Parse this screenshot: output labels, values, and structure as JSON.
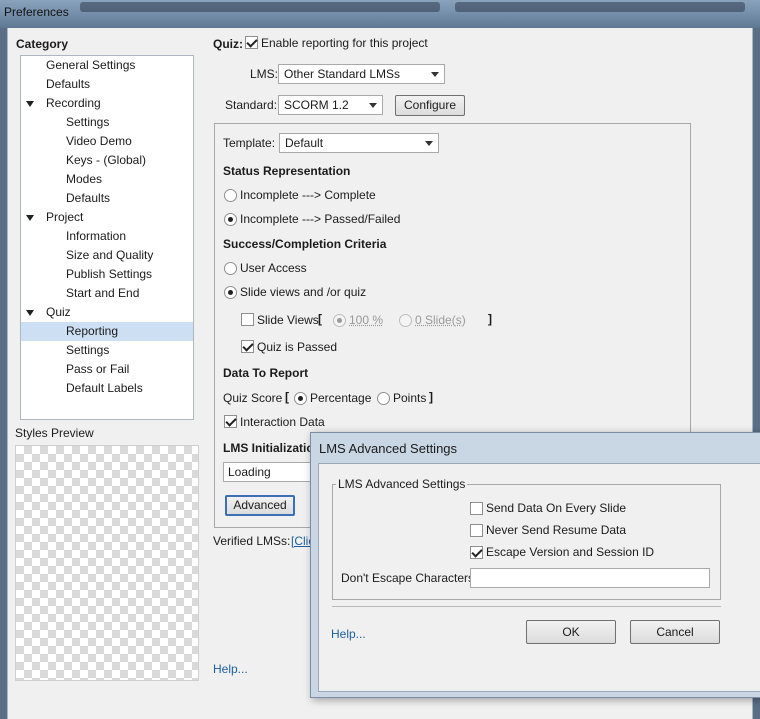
{
  "window": {
    "title": "Preferences"
  },
  "category": {
    "heading": "Category",
    "items": [
      {
        "label": "General Settings",
        "level": 1,
        "expander": false,
        "selected": false
      },
      {
        "label": "Defaults",
        "level": 1,
        "expander": false,
        "selected": false
      },
      {
        "label": "Recording",
        "level": 1,
        "expander": true,
        "selected": false
      },
      {
        "label": "Settings",
        "level": 2,
        "expander": false,
        "selected": false
      },
      {
        "label": "Video Demo",
        "level": 2,
        "expander": false,
        "selected": false
      },
      {
        "label": "Keys - (Global)",
        "level": 2,
        "expander": false,
        "selected": false
      },
      {
        "label": "Modes",
        "level": 2,
        "expander": false,
        "selected": false
      },
      {
        "label": "Defaults",
        "level": 2,
        "expander": false,
        "selected": false
      },
      {
        "label": "Project",
        "level": 1,
        "expander": true,
        "selected": false
      },
      {
        "label": "Information",
        "level": 2,
        "expander": false,
        "selected": false
      },
      {
        "label": "Size and Quality",
        "level": 2,
        "expander": false,
        "selected": false
      },
      {
        "label": "Publish Settings",
        "level": 2,
        "expander": false,
        "selected": false
      },
      {
        "label": "Start and End",
        "level": 2,
        "expander": false,
        "selected": false
      },
      {
        "label": "Quiz",
        "level": 1,
        "expander": true,
        "selected": false
      },
      {
        "label": "Reporting",
        "level": 2,
        "expander": false,
        "selected": true
      },
      {
        "label": "Settings",
        "level": 2,
        "expander": false,
        "selected": false
      },
      {
        "label": "Pass or Fail",
        "level": 2,
        "expander": false,
        "selected": false
      },
      {
        "label": "Default Labels",
        "level": 2,
        "expander": false,
        "selected": false
      }
    ]
  },
  "styles_preview": {
    "label": "Styles Preview"
  },
  "quiz": {
    "label": "Quiz:",
    "enable_reporting": {
      "label": "Enable reporting for this project",
      "checked": true
    },
    "lms_label": "LMS:",
    "lms_value": "Other Standard LMSs",
    "standard_label": "Standard:",
    "standard_value": "SCORM 1.2",
    "configure_button": "Configure",
    "template_label": "Template:",
    "template_value": "Default"
  },
  "status_representation": {
    "heading": "Status Representation",
    "option1": {
      "label": "Incomplete ---> Complete",
      "selected": false
    },
    "option2": {
      "label": "Incomplete ---> Passed/Failed",
      "selected": true
    }
  },
  "criteria": {
    "heading": "Success/Completion Criteria",
    "user_access": {
      "label": "User Access",
      "selected": false
    },
    "slide_views_quiz": {
      "label": "Slide views and /or quiz",
      "selected": true
    },
    "slide_views": {
      "label": "Slide Views",
      "checked": false
    },
    "bracket_open": "[",
    "bracket_close": "]",
    "percent_option": {
      "label": "100 %",
      "selected": true
    },
    "slides_option": {
      "label": "0 Slide(s)",
      "selected": false
    },
    "quiz_passed": {
      "label": "Quiz is Passed",
      "checked": true
    }
  },
  "data_to_report": {
    "heading": "Data To Report",
    "quiz_score_label": "Quiz Score",
    "bracket_open": "[",
    "bracket_close": "]",
    "percentage": {
      "label": "Percentage",
      "selected": true
    },
    "points": {
      "label": "Points",
      "selected": false
    },
    "interaction_data": {
      "label": "Interaction Data",
      "checked": true
    }
  },
  "lms_init": {
    "heading": "LMS Initializatio",
    "loading_value": "Loading",
    "advanced_button": "Advanced"
  },
  "verified": {
    "label": "Verified LMSs:",
    "link": "[Clic"
  },
  "help_link": "Help...",
  "dialog": {
    "title": "LMS Advanced Settings",
    "group_label": "LMS Advanced Settings",
    "send_every_slide": {
      "label": "Send Data On Every Slide",
      "checked": false
    },
    "never_send_resume": {
      "label": "Never Send Resume Data",
      "checked": false
    },
    "escape_version": {
      "label": "Escape Version and Session ID",
      "checked": true
    },
    "dont_escape_label": "Don't Escape Characters:",
    "dont_escape_value": "",
    "help_link": "Help...",
    "ok_button": "OK",
    "cancel_button": "Cancel"
  }
}
